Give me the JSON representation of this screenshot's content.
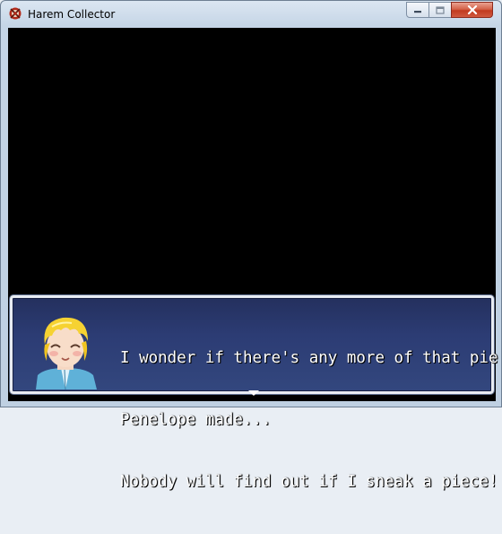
{
  "window": {
    "title": "Harem Collector",
    "icon": "rpg-maker-icon",
    "controls": [
      "minimize-icon",
      "maximize-icon",
      "close-icon"
    ]
  },
  "dialog": {
    "portrait": "blonde-boy-smiling-face",
    "lines": [
      "I wonder if there's any more of that pie",
      "Penelope made...",
      "Nobody will find out if I sneak a piece!"
    ],
    "continue_indicator": "down-arrow-icon"
  },
  "colors": {
    "game_background": "#000000",
    "message_box_top": "#24305e",
    "message_box_bottom": "#33477e",
    "message_border": "#e8ecf3",
    "close_button": "#c23a1f"
  }
}
